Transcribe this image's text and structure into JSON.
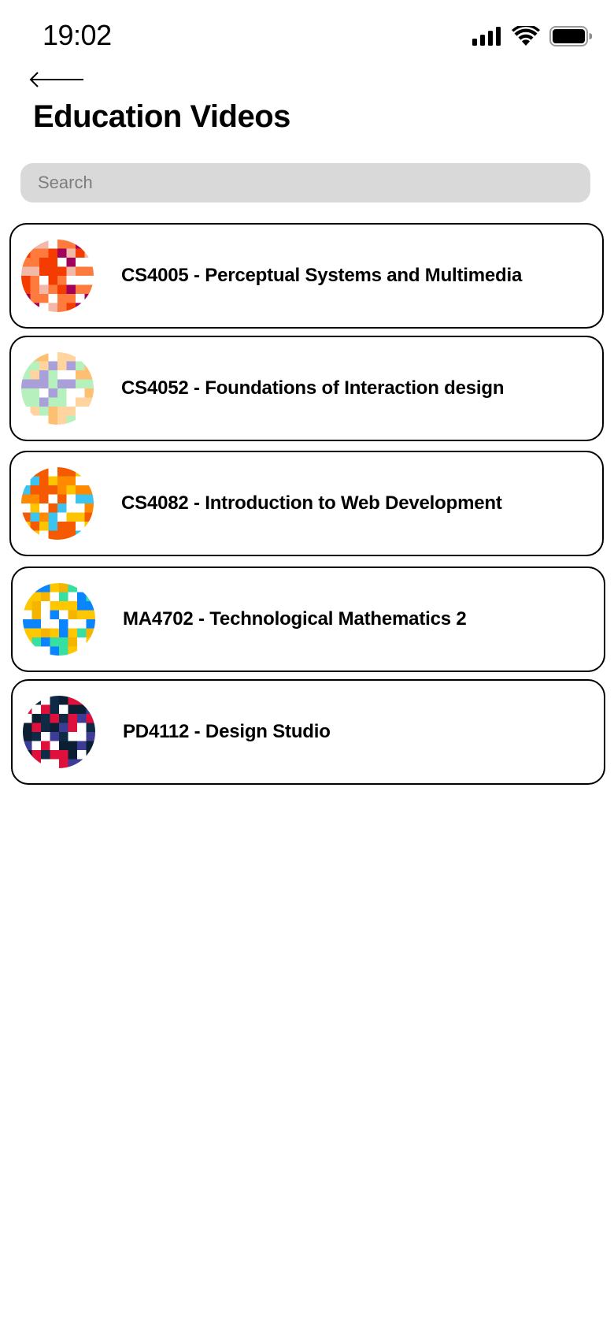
{
  "status_bar": {
    "time": "19:02"
  },
  "header": {
    "title": "Education Videos"
  },
  "search": {
    "placeholder": "Search",
    "value": ""
  },
  "courses": [
    {
      "label": "CS4005 - Perceptual Systems and Multimedia",
      "palette": [
        "#ffffff",
        "#f53c00",
        "#a3005c",
        "#f2b8a8",
        "#ff7a3d"
      ]
    },
    {
      "label": "CS4052 - Foundations of Interaction design",
      "palette": [
        "#ffffff",
        "#ffbf73",
        "#a9a0d9",
        "#b6f0bc",
        "#ffd49e"
      ]
    },
    {
      "label": "CS4082 - Introduction to Web Development",
      "palette": [
        "#ffffff",
        "#ff8a00",
        "#3cc3f0",
        "#ffc400",
        "#f55a00"
      ]
    },
    {
      "label": "MA4702 - Technological Mathematics 2",
      "palette": [
        "#ffffff",
        "#ffc700",
        "#0a84ff",
        "#37e0a0",
        "#f5b400"
      ]
    },
    {
      "label": "PD4112 - Design Studio",
      "palette": [
        "#ffffff",
        "#0f2a44",
        "#3c3c96",
        "#e0103c",
        "#0b1f33"
      ]
    }
  ],
  "colors": {
    "search_background": "#d9d9d9",
    "card_border": "#000000",
    "text": "#000000"
  }
}
